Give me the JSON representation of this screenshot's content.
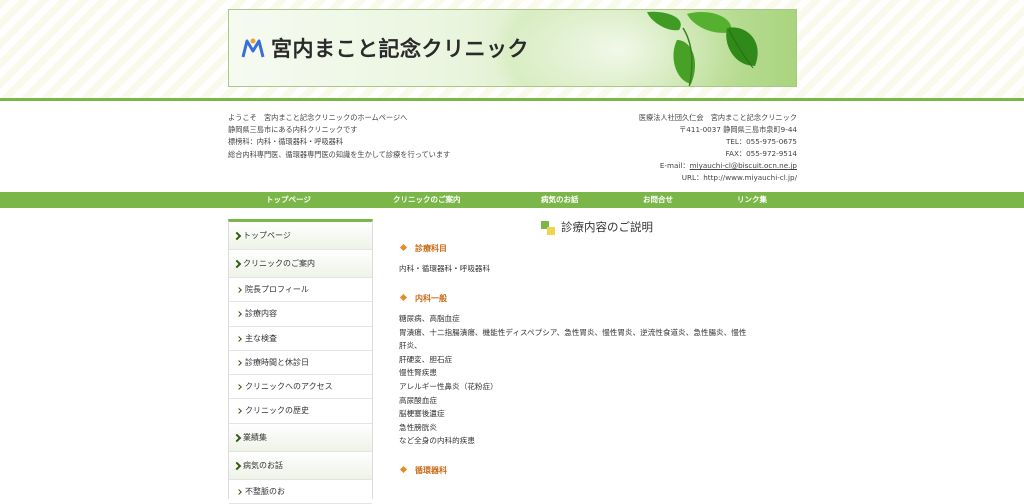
{
  "banner": {
    "clinic_name": "宮内まこと記念クリニック"
  },
  "intro": {
    "lines": [
      "ようこそ　宮内まこと記念クリニックのホームページへ",
      "静岡県三島市にある内科クリニックです",
      "標榜科：内科・循環器科・呼吸器科",
      "総合内科専門医、循環器専門医の知識を生かして診療を行っています"
    ]
  },
  "contact": {
    "org": "医療法人社団久仁会　宮内まこと記念クリニック",
    "address": "〒411-0037 静岡県三島市泉町9-44",
    "tel": "TEL：055-975-0675",
    "fax": "FAX：055-972-9514",
    "email_label": "E-mail：",
    "email": "miyauchi-cl@biscuit.ocn.ne.jp",
    "url": "URL：http://www.miyauchi-cl.jp/"
  },
  "nav": {
    "items": [
      "トップページ",
      "クリニックのご案内",
      "病気のお話",
      "お問合せ",
      "リンク集"
    ]
  },
  "sidebar": {
    "items": [
      {
        "label": "トップページ",
        "type": "main"
      },
      {
        "label": "クリニックのご案内",
        "type": "main"
      },
      {
        "label": "院長プロフィール",
        "type": "sub"
      },
      {
        "label": "診療内容",
        "type": "sub"
      },
      {
        "label": "主な検査",
        "type": "sub"
      },
      {
        "label": "診療時間と休診日",
        "type": "sub"
      },
      {
        "label": "クリニックへのアクセス",
        "type": "sub"
      },
      {
        "label": "クリニックの歴史",
        "type": "sub"
      },
      {
        "label": "業績集",
        "type": "main"
      },
      {
        "label": "病気のお話",
        "type": "main"
      },
      {
        "label": "不整脈のお",
        "type": "sub"
      }
    ]
  },
  "main": {
    "title": "診療内容のご説明",
    "sections": [
      {
        "heading": "診療科目",
        "lines": [
          "内科・循環器科・呼吸器科"
        ]
      },
      {
        "heading": "内科一般",
        "lines": [
          "糖尿病、高脂血症",
          "胃潰瘍、十二指腸潰瘍、機能性ディスペプシア、急性胃炎、慢性胃炎、逆流性食道炎、急性腸炎、慢性",
          "肝炎、",
          "肝硬変、胆石症",
          "慢性腎疾患",
          "アレルギー性鼻炎（花粉症）",
          "高尿酸血症",
          "脳梗塞後遺症",
          "急性膀胱炎",
          "など全身の内科的疾患"
        ]
      },
      {
        "heading": "循環器科",
        "lines": []
      }
    ]
  },
  "colors": {
    "accent_green": "#7ab648",
    "heading_orange": "#c86e1c"
  }
}
